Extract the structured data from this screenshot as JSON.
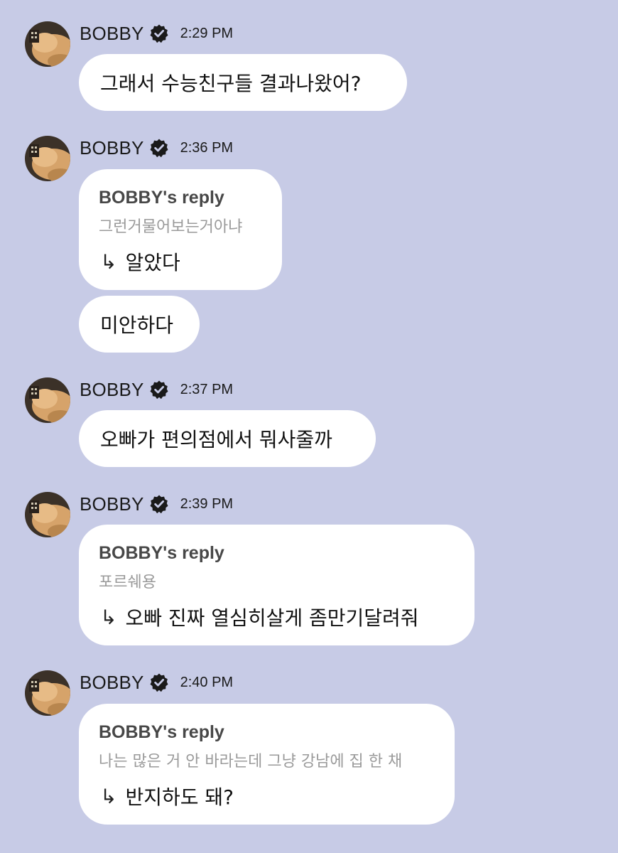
{
  "messages": [
    {
      "sender": "BOBBY",
      "time": "2:29 PM",
      "text": "그래서 수능친구들 결과나왔어?"
    },
    {
      "sender": "BOBBY",
      "time": "2:36 PM",
      "reply": {
        "title": "BOBBY's reply",
        "quote": "그런거물어보는거아냐",
        "arrow": "↳",
        "answer": "알았다"
      },
      "text2": "미안하다"
    },
    {
      "sender": "BOBBY",
      "time": "2:37 PM",
      "text": "오빠가 편의점에서 뭐사줄까"
    },
    {
      "sender": "BOBBY",
      "time": "2:39 PM",
      "reply": {
        "title": "BOBBY's reply",
        "quote": "포르쉐용",
        "arrow": "↳",
        "answer": "오빠 진짜 열심히살게 좀만기달려줘"
      }
    },
    {
      "sender": "BOBBY",
      "time": "2:40 PM",
      "reply": {
        "title": "BOBBY's reply",
        "quote": "나는 많은 거 안 바라는데 그냥 강남에 집 한 채",
        "arrow": "↳",
        "answer": "반지하도 돼?"
      }
    }
  ],
  "colors": {
    "background": "#c7cbe6",
    "bubble": "#ffffff",
    "badge": "#1a1a1a"
  },
  "icons": {
    "verified": "verified-badge-icon",
    "avatar": "profile-avatar"
  }
}
